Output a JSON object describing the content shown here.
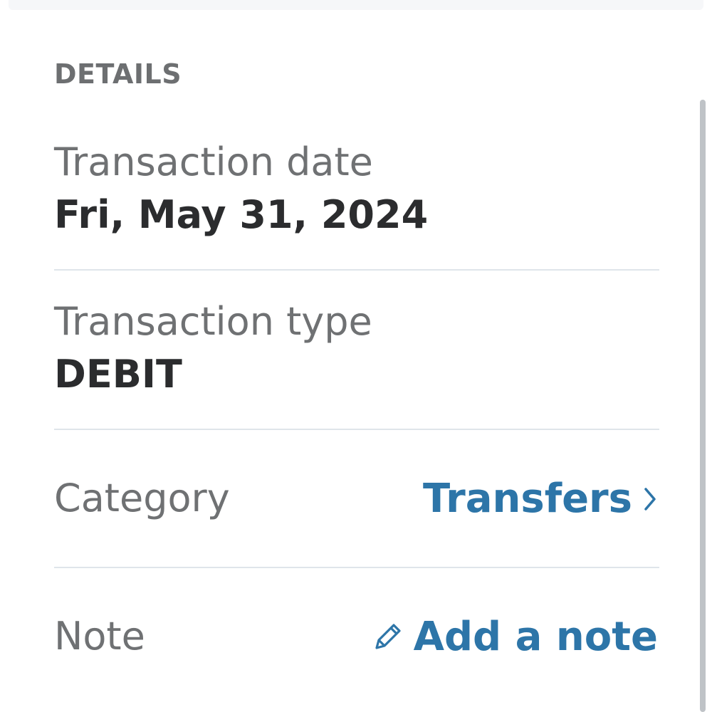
{
  "details": {
    "title": "DETAILS",
    "transaction_date": {
      "label": "Transaction date",
      "value": "Fri, May 31, 2024"
    },
    "transaction_type": {
      "label": "Transaction type",
      "value": "DEBIT"
    },
    "category": {
      "label": "Category",
      "value": "Transfers",
      "icon": "chevron-right-icon"
    },
    "note": {
      "label": "Note",
      "action": "Add a note",
      "icon": "pencil-icon"
    }
  },
  "colors": {
    "accent": "#2d75a8",
    "label": "#6f7173",
    "value": "#2b2c2e",
    "divider": "#dfe5ea"
  }
}
